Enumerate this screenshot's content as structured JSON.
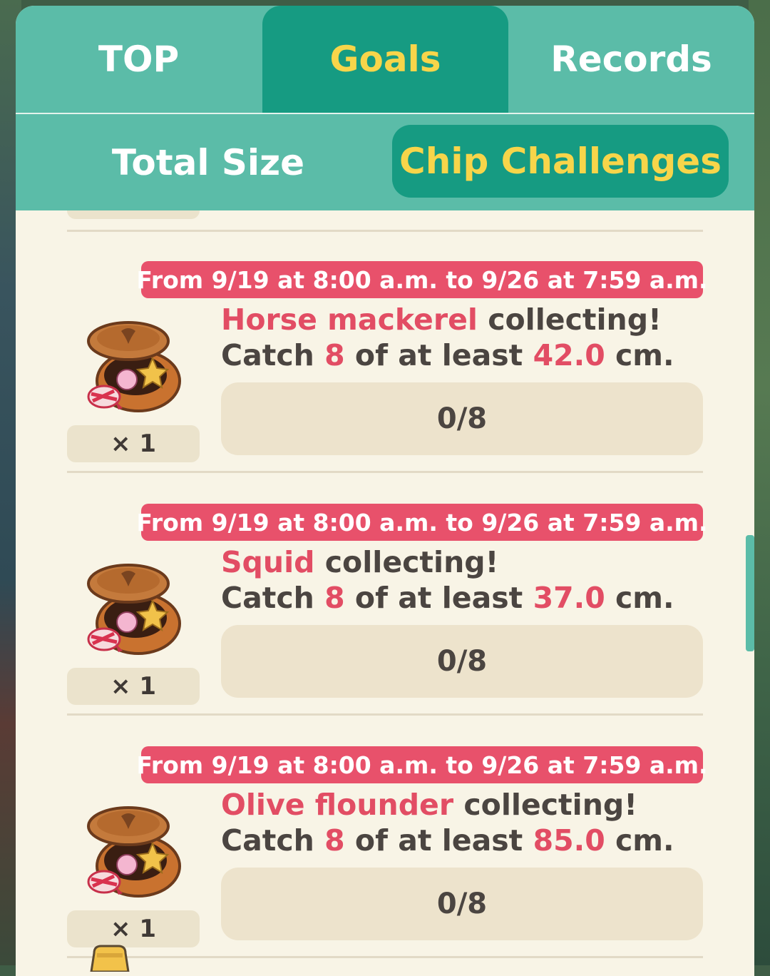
{
  "tabs": [
    {
      "label": "TOP",
      "active": false
    },
    {
      "label": "Goals",
      "active": true
    },
    {
      "label": "Records",
      "active": false
    }
  ],
  "subtabs": [
    {
      "label": "Total Size",
      "active": false
    },
    {
      "label": "Chip Challenges",
      "active": true
    }
  ],
  "challenges": [
    {
      "period": "From 9/19 at 8:00 a.m. to 9/26 at 7:59 a.m.",
      "fish": "Horse mackerel",
      "suffix": " collecting!",
      "catch_prefix": "Catch ",
      "count": "8",
      "mid": " of at least ",
      "size": "42.0",
      "unit": " cm.",
      "progress": "0/8",
      "reward_count": "× 1",
      "reward_icon": "chest-icon"
    },
    {
      "period": "From 9/19 at 8:00 a.m. to 9/26 at 7:59 a.m.",
      "fish": "Squid",
      "suffix": " collecting!",
      "catch_prefix": "Catch ",
      "count": "8",
      "mid": " of at least ",
      "size": "37.0",
      "unit": " cm.",
      "progress": "0/8",
      "reward_count": "× 1",
      "reward_icon": "chest-icon"
    },
    {
      "period": "From 9/19 at 8:00 a.m. to 9/26 at 7:59 a.m.",
      "fish": "Olive flounder",
      "suffix": " collecting!",
      "catch_prefix": "Catch ",
      "count": "8",
      "mid": " of at least ",
      "size": "85.0",
      "unit": " cm.",
      "progress": "0/8",
      "reward_count": "× 1",
      "reward_icon": "chest-icon"
    }
  ],
  "colors": {
    "accent": "#e8516b",
    "tab_bg": "#5bbca8",
    "tab_active": "#169b82",
    "tab_active_text": "#f7d54a",
    "panel_bg": "#f8f4e6"
  }
}
